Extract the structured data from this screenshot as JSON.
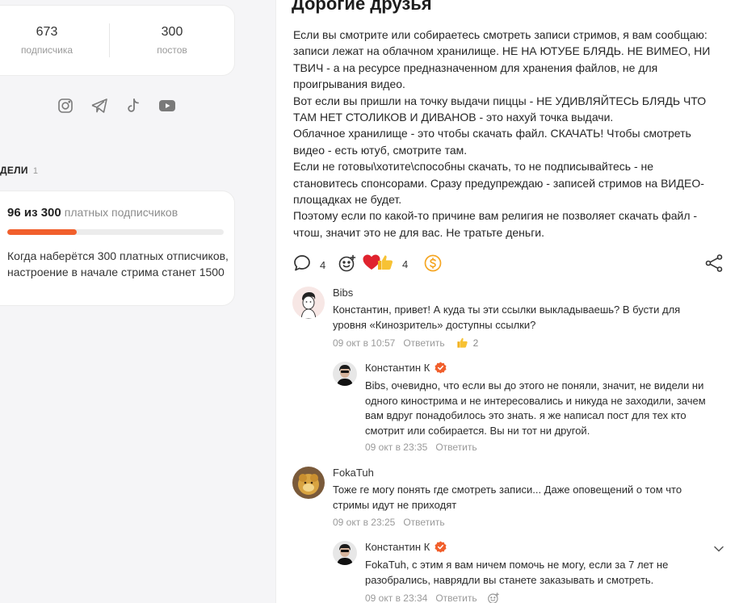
{
  "stats": {
    "subscribers_count": "673",
    "subscribers_label": "подписчика",
    "posts_count": "300",
    "posts_label": "постов"
  },
  "socials": [
    "instagram-icon",
    "telegram-icon",
    "tiktok-icon",
    "youtube-icon"
  ],
  "goals": {
    "heading": "ДЕЛИ",
    "count": "1",
    "current": "96 из 300",
    "unit": "платных подписчиков",
    "progress_fraction": 0.32,
    "description": "Когда наберётся 300 платных отписчиков, настроение в начале стрима станет 1500"
  },
  "post": {
    "title": "Дорогие друзья",
    "paragraphs": [
      "Если вы смотрите или собираетесь смотреть записи стримов, я вам сообщаю: записи лежат на облачном хранилище. НЕ НА ЮТУБЕ БЛЯДЬ. НЕ ВИМЕО, НИ ТВИЧ - а на ресурсе предназначенном для хранения файлов, не для проигрывания видео.",
      "Вот если вы пришли на точку выдачи пиццы - НЕ УДИВЛЯЙТЕСЬ БЛЯДЬ ЧТО ТАМ НЕТ СТОЛИКОВ И ДИВАНОВ - это нахуй точка выдачи.",
      "Облачное хранилище - это чтобы скачать файл. СКАЧАТЬ! Чтобы смотреть видео - есть ютуб, смотрите там.",
      "Если не готовы\\хотите\\способны скачать, то не подписывайтесь - не становитесь спонсорами. Сразу предупреждаю - записей стримов на ВИДЕО-площадках не будет.",
      "Поэтому если по какой-то причине вам религия не позволяет скачать файл - чтош, значит это не для вас. Не тратьте деньги."
    ],
    "comments_count": "4",
    "reactions_count": "4"
  },
  "comments": [
    {
      "author": "Bibs",
      "text": "Константин, привет! А куда ты эти ссылки выкладываешь? В бусти для уровня «Кинозритель» доступны ссылки?",
      "time": "09 окт в 10:57",
      "reply_label": "Ответить",
      "likes": "2"
    },
    {
      "author": "Константин К",
      "text": "Bibs, очевидно, что если вы до этого не поняли, значит, не видели ни одного кинострима и не интересовались и никуда не заходили, зачем вам вдруг понадобилось это знать. я же написал пост для тех кто смотрит или собирается. Вы ни тот ни другой.",
      "time": "09 окт в 23:35",
      "reply_label": "Ответить"
    },
    {
      "author": "FokaTuh",
      "text": "Тоже ге могу понять где смотреть записи... Даже оповещений о том что стримы идут не приходят",
      "time": "09 окт в 23:25",
      "reply_label": "Ответить"
    },
    {
      "author": "Константин К",
      "text": "FokaTuh, с этим я вам ничем помочь не могу, если за 7 лет не разобрались, наврядли вы станете заказывать и смотреть.",
      "time": "09 окт в 23:34",
      "reply_label": "Ответить"
    }
  ],
  "colors": {
    "accent": "#f15f2c",
    "donate": "#f5a623",
    "verified": "#f15f2c"
  }
}
